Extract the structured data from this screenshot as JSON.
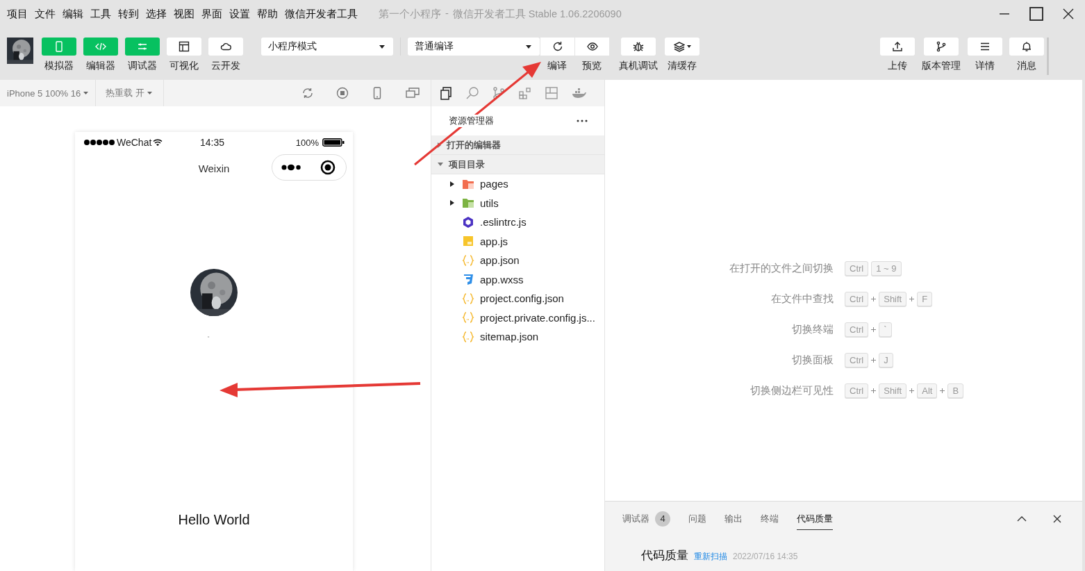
{
  "menu": [
    "项目",
    "文件",
    "编辑",
    "工具",
    "转到",
    "选择",
    "视图",
    "界面",
    "设置",
    "帮助",
    "微信开发者工具"
  ],
  "window": {
    "title": "第一个小程序",
    "separator": "-",
    "app": "微信开发者工具 Stable 1.06.2206090"
  },
  "toolbar": {
    "toggles": [
      {
        "label": "模拟器",
        "kind": "phone",
        "selected": true
      },
      {
        "label": "编辑器",
        "kind": "code",
        "selected": true
      },
      {
        "label": "调试器",
        "kind": "sliders",
        "selected": true
      },
      {
        "label": "可视化",
        "kind": "layout",
        "selected": false
      },
      {
        "label": "云开发",
        "kind": "cloud",
        "selected": false
      }
    ],
    "mode": "小程序模式",
    "compile": "普通编译",
    "actions": [
      {
        "label": "编译",
        "kind": "refresh"
      },
      {
        "label": "预览",
        "kind": "eye"
      },
      {
        "label": "真机调试",
        "kind": "bug"
      },
      {
        "label": "清缓存",
        "kind": "layers"
      }
    ],
    "right": [
      {
        "label": "上传",
        "kind": "upload"
      },
      {
        "label": "版本管理",
        "kind": "branch"
      },
      {
        "label": "详情",
        "kind": "list"
      },
      {
        "label": "消息",
        "kind": "bell"
      }
    ]
  },
  "simulator": {
    "device": "iPhone 5 100% 16",
    "hot_reload": "热重载 开",
    "phone": {
      "carrier": "WeChat",
      "time": "14:35",
      "battery": "100%",
      "nav_title": "Weixin",
      "nickname": "。",
      "text": "Hello World"
    }
  },
  "explorer": {
    "title": "资源管理器",
    "sections": [
      {
        "label": "打开的编辑器",
        "expanded": false
      },
      {
        "label": "项目目录",
        "expanded": true,
        "children": [
          {
            "name": "pages",
            "kind": "folder-red",
            "expanded": false
          },
          {
            "name": "utils",
            "kind": "folder-green",
            "expanded": false
          },
          {
            "name": ".eslintrc.js",
            "kind": "eslint"
          },
          {
            "name": "app.js",
            "kind": "js"
          },
          {
            "name": "app.json",
            "kind": "json"
          },
          {
            "name": "app.wxss",
            "kind": "css"
          },
          {
            "name": "project.config.json",
            "kind": "json"
          },
          {
            "name": "project.private.config.js...",
            "kind": "json"
          },
          {
            "name": "sitemap.json",
            "kind": "json"
          }
        ]
      }
    ]
  },
  "shortcuts": [
    {
      "label": "在打开的文件之间切换",
      "keys": [
        "Ctrl",
        "1 ~ 9"
      ],
      "joined": false
    },
    {
      "label": "在文件中查找",
      "keys": [
        "Ctrl",
        "Shift",
        "F"
      ],
      "joined": true
    },
    {
      "label": "切换终端",
      "keys": [
        "Ctrl",
        "`"
      ],
      "joined": true
    },
    {
      "label": "切换面板",
      "keys": [
        "Ctrl",
        "J"
      ],
      "joined": true
    },
    {
      "label": "切换侧边栏可见性",
      "keys": [
        "Ctrl",
        "Shift",
        "Alt",
        "B"
      ],
      "joined": true
    }
  ],
  "bottom_panel": {
    "tabs": [
      {
        "label": "调试器",
        "badge": "4",
        "selected": false
      },
      {
        "label": "问题",
        "selected": false
      },
      {
        "label": "输出",
        "selected": false
      },
      {
        "label": "终端",
        "selected": false
      },
      {
        "label": "代码质量",
        "selected": true
      }
    ],
    "heading": "代码质量",
    "link": "重新扫描",
    "time": "2022/07/16 14:35"
  }
}
